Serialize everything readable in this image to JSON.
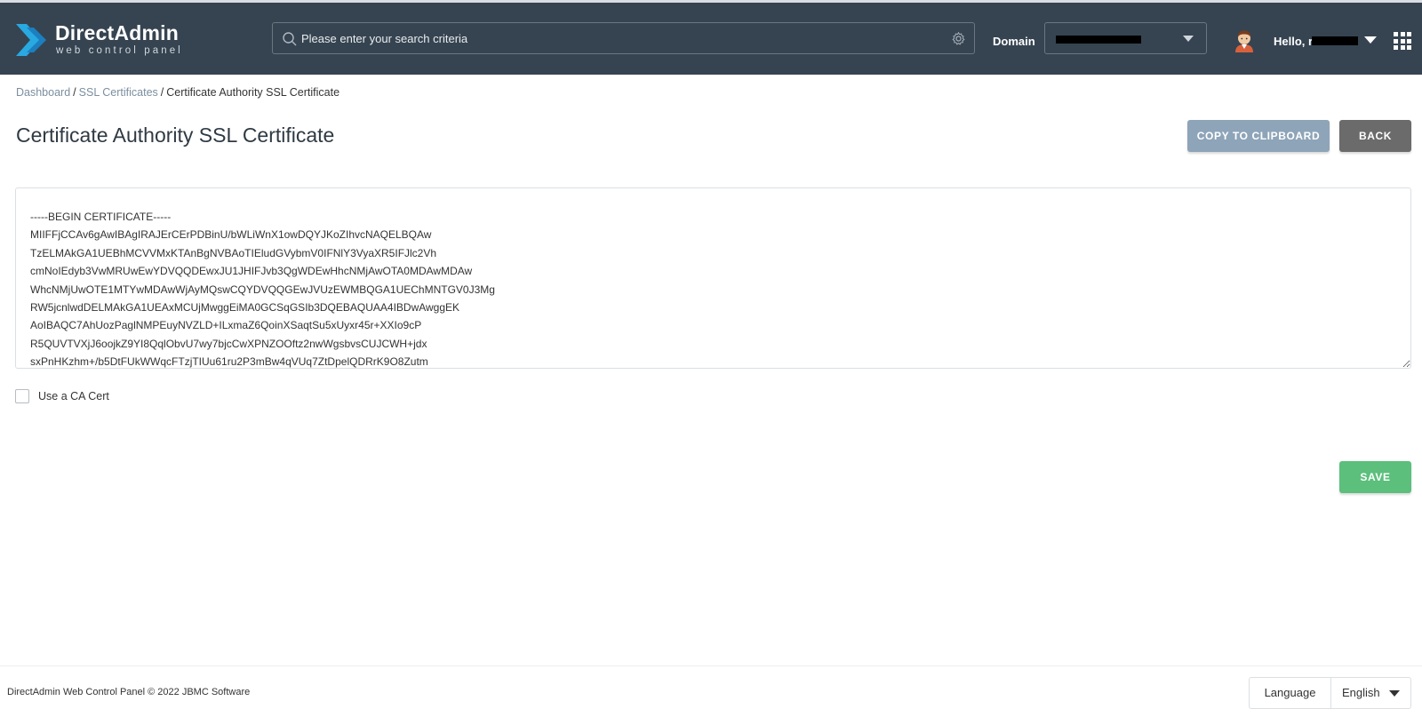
{
  "header": {
    "logo_title": "DirectAdmin",
    "logo_subtitle": "web control panel",
    "search_placeholder": "Please enter your search criteria",
    "domain_label": "Domain",
    "hello_text": "Hello, r",
    "icons": [
      "search-icon",
      "gear-icon",
      "chevron-down-icon",
      "avatar-icon",
      "apps-grid-icon"
    ]
  },
  "breadcrumb": {
    "items": [
      "Dashboard",
      "SSL Certificates",
      "Certificate Authority SSL Certificate"
    ],
    "separator": "/"
  },
  "page": {
    "title": "Certificate Authority SSL Certificate",
    "copy_label": "COPY TO CLIPBOARD",
    "back_label": "BACK",
    "save_label": "SAVE",
    "ca_checkbox_label": "Use a CA Cert",
    "ca_checked": false,
    "certificate": "-----BEGIN CERTIFICATE-----\nMIIFFjCCAv6gAwIBAgIRAJErCErPDBinU/bWLiWnX1owDQYJKoZIhvcNAQELBQAw\nTzELMAkGA1UEBhMCVVMxKTAnBgNVBAoTIEludGVybmV0IFNlY3VyaXR5IFJlc2Vh\ncmNoIEdyb3VwMRUwEwYDVQQDEwxJU1JHIFJvb3QgWDEwHhcNMjAwOTA0MDAwMDAw\nWhcNMjUwOTE1MTYwMDAwWjAyMQswCQYDVQQGEwJVUzEWMBQGA1UEChMNTGV0J3Mg\nRW5jcnlwdDELMAkGA1UEAxMCUjMwggEiMA0GCSqGSIb3DQEBAQUAA4IBDwAwggEK\nAoIBAQC7AhUozPaglNMPEuyNVZLD+ILxmaZ6QoinXSaqtSu5xUyxr45r+XXIo9cP\nR5QUVTVXjJ6oojkZ9YI8QqlObvU7wy7bjcCwXPNZOOftz2nwWgsbvsCUJCWH+jdx\nsxPnHKzhm+/b5DtFUkWWqcFTzjTIUu61ru2P3mBw4qVUq7ZtDpelQDRrK9O8Zutm"
  },
  "footer": {
    "copyright": "DirectAdmin Web Control Panel © 2022 JBMC Software",
    "language_label": "Language",
    "language_value": "English"
  },
  "colors": {
    "header_bg": "#364451",
    "copy_button": "#8ea4b8",
    "back_button": "#6b6b6b",
    "save_button": "#5cbf7c",
    "link": "#7b8f9f",
    "logo_blue": "#29a9e1"
  }
}
